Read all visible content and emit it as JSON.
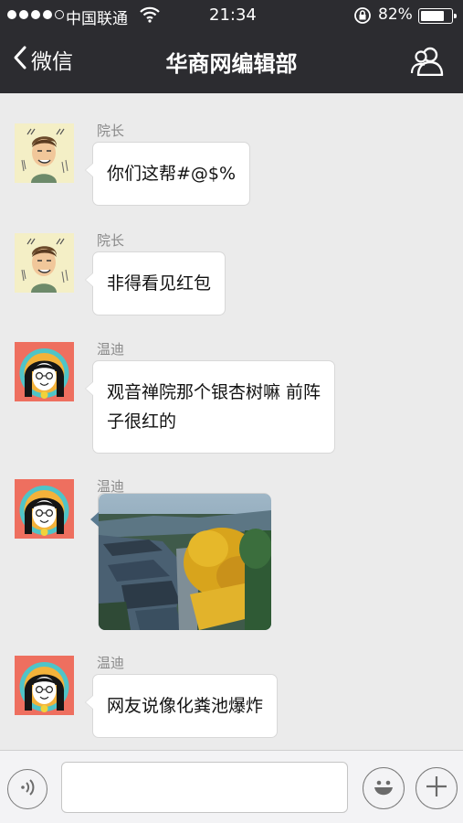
{
  "status_bar": {
    "carrier": "中国联通",
    "time": "21:34",
    "battery_percent": "82%",
    "battery_level": 0.82,
    "signal_bars": 4,
    "signal_total": 5
  },
  "nav": {
    "back_label": "微信",
    "title": "华商网编辑部",
    "back_icon": "chevron-left-icon",
    "profile_icon": "group-profile-icon"
  },
  "messages": [
    {
      "sender": "院长",
      "type": "text",
      "lines": [
        "你们这帮#@$%"
      ]
    },
    {
      "sender": "院长",
      "type": "text",
      "lines": [
        "非得看见红包"
      ]
    },
    {
      "sender": "温迪",
      "type": "text",
      "lines": [
        "观音禅院那个银杏树嘛 前阵",
        "子很红的"
      ]
    },
    {
      "sender": "温迪",
      "type": "image",
      "image_desc": "ginkgo-temple-photo"
    },
    {
      "sender": "温迪",
      "type": "text",
      "lines": [
        "网友说像化粪池爆炸"
      ]
    }
  ],
  "input_bar": {
    "voice_icon": "voice-icon",
    "emoji_icon": "emoji-icon",
    "plus_icon": "plus-icon",
    "text_value": ""
  },
  "colors": {
    "header_bg": "#2c2c30",
    "chat_bg": "#ebebeb",
    "bubble_bg": "#ffffff"
  }
}
